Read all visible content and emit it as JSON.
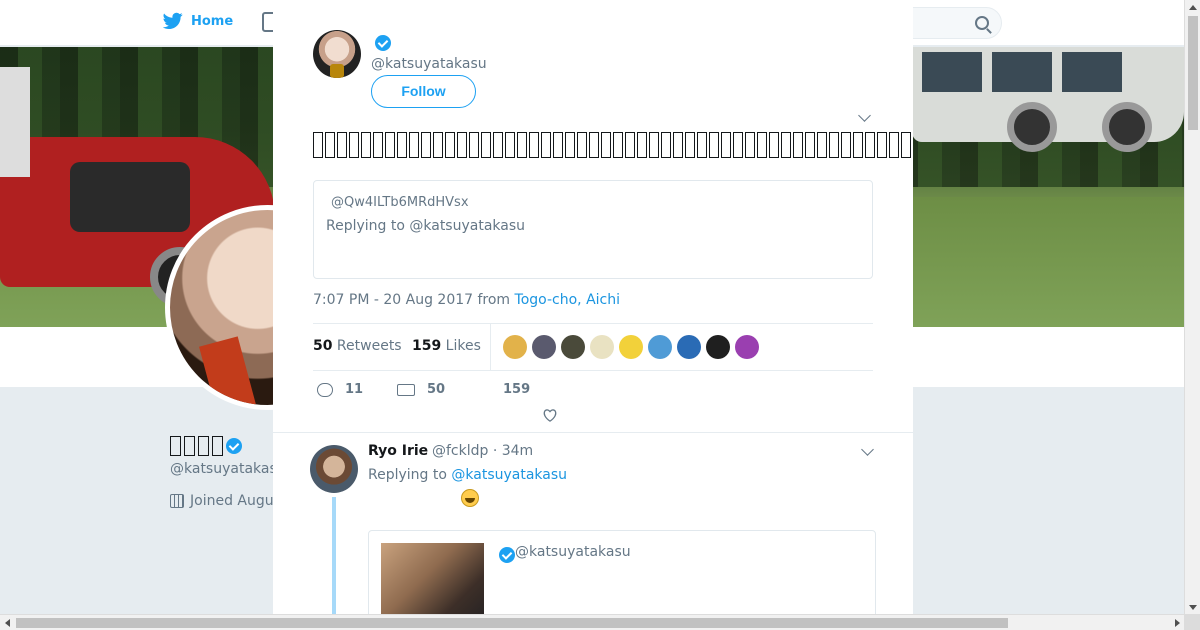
{
  "nav": {
    "home_label": "Home"
  },
  "profile": {
    "name_glyph_count": 4,
    "handle": "@katsuyatakasu",
    "joined": "Joined Augu"
  },
  "tweet": {
    "handle": "@katsuyatakasu",
    "follow_label": "Follow",
    "text_glyph_count": 50,
    "quote": {
      "handle": "@Qw4ILTb6MRdHVsx",
      "replying": "Replying to @katsuyatakasu"
    },
    "time": "7:07 PM - 20 Aug 2017 from ",
    "location": "Togo-cho, Aichi",
    "retweets_count": "50",
    "retweets_label": " Retweets",
    "likes_count": "159",
    "likes_label": " Likes",
    "likers_colors": [
      "#e2b24a",
      "#5a5a6e",
      "#4a4a3a",
      "#e9e2c2",
      "#f2d13a",
      "#4f9bd6",
      "#2a6bb5",
      "#1f1f1f",
      "#9a3fb0"
    ],
    "reply_count": "11",
    "retweet_count": "50",
    "like_count": "159"
  },
  "reply": {
    "name": "Ryo Irie",
    "handle": "@fckldp · 34m",
    "replying_prefix": "Replying to ",
    "replying_link": "@katsuyatakasu",
    "quote_handle": "@katsuyatakasu"
  },
  "colors": {
    "accent": "#1da1f2",
    "link": "#1b95e0",
    "muted": "#657786"
  }
}
